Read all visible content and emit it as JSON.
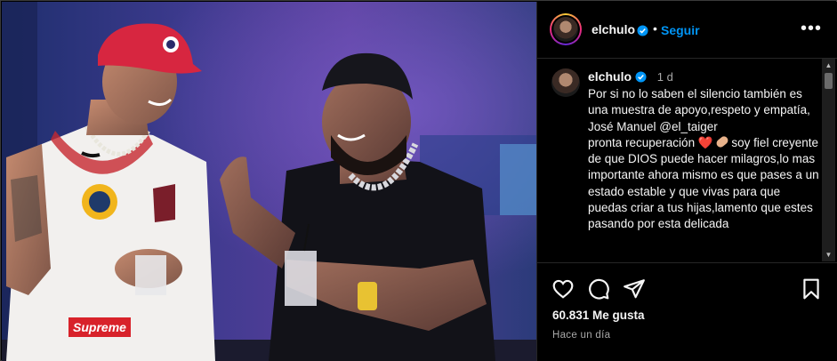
{
  "post": {
    "username": "elchulo",
    "follow_label": "Seguir",
    "separator": "•",
    "more_label": "•••"
  },
  "caption": {
    "username": "elchulo",
    "time": "1 d",
    "lines": [
      "Por si no lo saben el silencio también es una muestra de apoyo,respeto y empatía,",
      "José Manuel @el_taiger",
      "pronta recuperación",
      "soy fiel creyente de que DIOS puede hacer milagros,lo mas importante ahora mismo es que pases a un estado estable y que vivas para que puedas criar a tus hijas,lamento que estes pasando por esta delicada"
    ],
    "emoji": [
      "❤️",
      "🩹"
    ]
  },
  "stats": {
    "likes": "60.831 Me gusta",
    "posted": "Hace un día"
  },
  "icons": {
    "like": "heart-icon",
    "comment": "comment-icon",
    "share": "share-icon",
    "save": "bookmark-icon",
    "verified": "verified-badge-icon",
    "more": "more-options-icon"
  },
  "colors": {
    "accent": "#0095f6",
    "background": "#000000",
    "text": "#f5f5f5",
    "muted": "#a8a8a8",
    "heart": "#e0242f"
  }
}
